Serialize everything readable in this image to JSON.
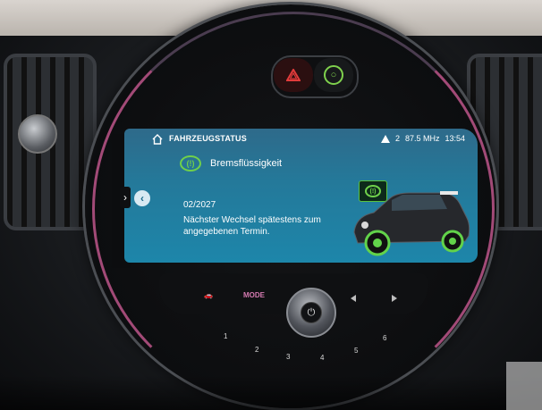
{
  "header": {
    "title": "FAHRZEUGSTATUS",
    "alert_count": "2",
    "radio": "87.5 MHz",
    "time": "13:54"
  },
  "service": {
    "item": "Bremsflüssigkeit",
    "date": "02/2027",
    "message": "Nächster Wechsel spätestens zum angegebenen Termin."
  },
  "controls": {
    "mode_label": "MODE",
    "presets": [
      "1",
      "2",
      "3",
      "4",
      "5",
      "6"
    ]
  },
  "colors": {
    "accent_green": "#6fd04b",
    "screen_blue": "#1d86aa",
    "ring_pink": "#c85a92"
  },
  "icons": {
    "home": "home-icon",
    "warning": "warning-triangle-icon",
    "brake": "brake-fluid-icon",
    "hazard": "hazard-icon",
    "eco": "eco-icon",
    "power": "power-icon"
  }
}
